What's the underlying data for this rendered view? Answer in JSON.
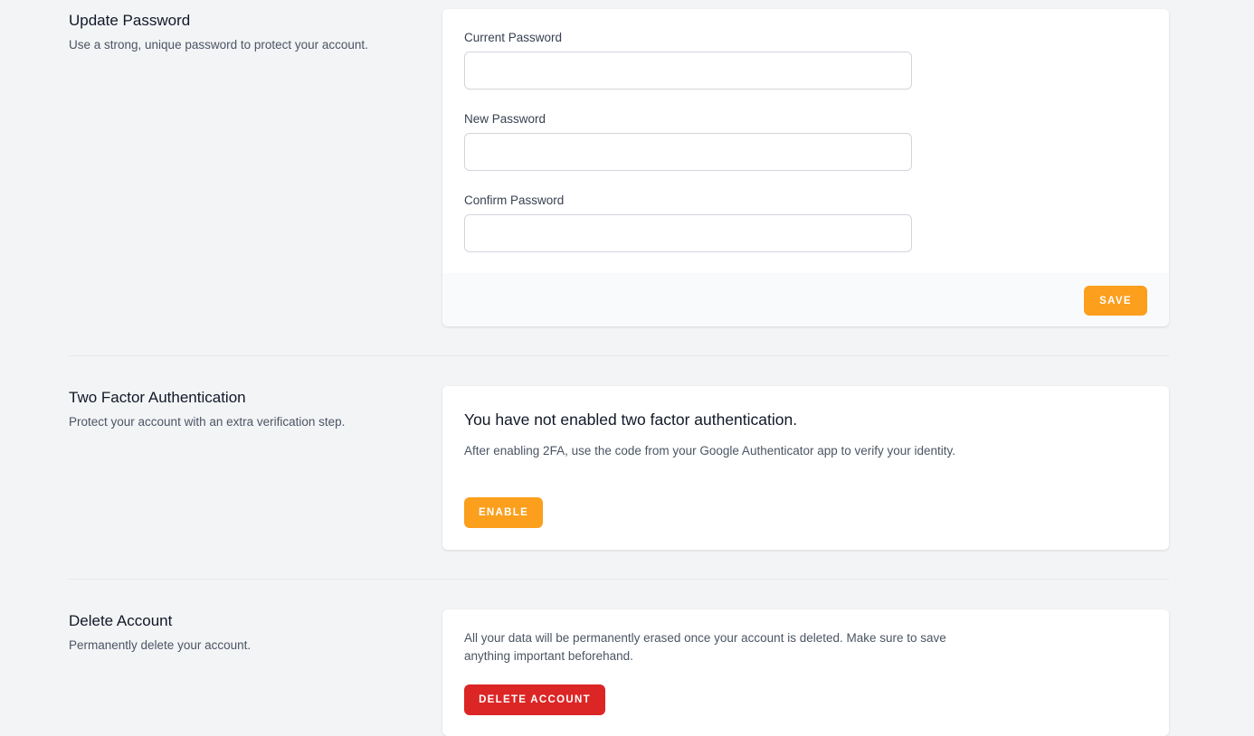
{
  "update_password": {
    "title": "Update Password",
    "description": "Use a strong, unique password to protect your account.",
    "fields": [
      {
        "label": "Current Password",
        "value": ""
      },
      {
        "label": "New Password",
        "value": ""
      },
      {
        "label": "Confirm Password",
        "value": ""
      }
    ],
    "save_label": "SAVE"
  },
  "two_factor": {
    "title": "Two Factor Authentication",
    "description": "Protect your account with an extra verification step.",
    "status_heading": "You have not enabled two factor authentication.",
    "info_text": "After enabling 2FA, use the code from your Google Authenticator app to verify your identity.",
    "enable_label": "ENABLE"
  },
  "delete_account": {
    "title": "Delete Account",
    "description": "Permanently delete your account.",
    "warning_text": "All your data will be permanently erased once your account is deleted. Make sure to save anything important beforehand.",
    "delete_label": "DELETE ACCOUNT"
  },
  "colors": {
    "primary_button": "#fb9f1c",
    "danger_button": "#dc2626",
    "page_background": "#f3f4f6"
  }
}
